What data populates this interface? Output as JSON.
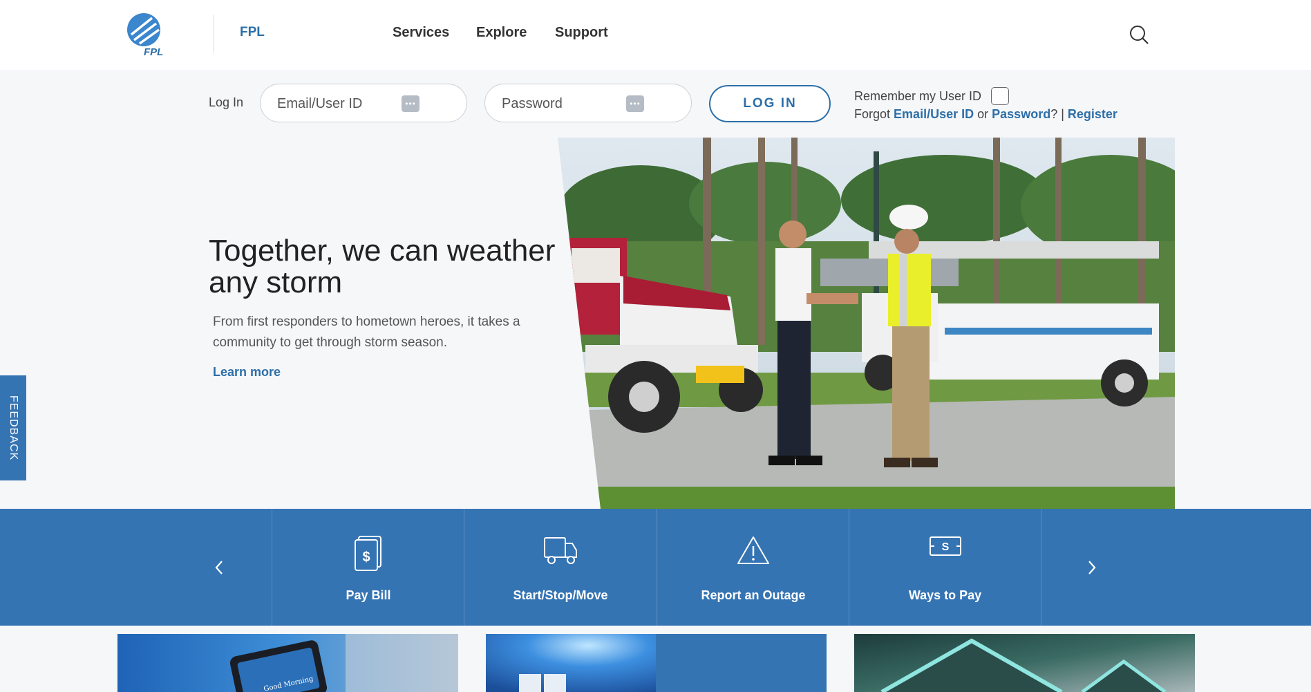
{
  "header": {
    "brand": "FPL",
    "logo_text": "FPL",
    "nav": [
      "Services",
      "Explore",
      "Support"
    ]
  },
  "login": {
    "label": "Log In",
    "email_placeholder": "Email/User ID",
    "password_placeholder": "Password",
    "button": "LOG IN",
    "remember": "Remember my User ID",
    "forgot_prefix": "Forgot",
    "forgot_email": "Email/User ID",
    "forgot_or": "or",
    "forgot_password": "Password",
    "forgot_suffix": "? |",
    "register": "Register"
  },
  "hero": {
    "title": "Together, we can weather any storm",
    "description": "From first responders to hometown heroes, it takes a community to get through storm season.",
    "link": "Learn more"
  },
  "feedback": "FEEDBACK",
  "actions": [
    {
      "label": "Pay Bill",
      "icon": "bill-dollar-icon"
    },
    {
      "label": "Start/Stop/Move",
      "icon": "truck-icon"
    },
    {
      "label": "Report an Outage",
      "icon": "warning-icon"
    },
    {
      "label": "Ways to Pay",
      "icon": "cash-icon"
    }
  ],
  "phone_screen_text": "Good Morning",
  "colors": {
    "brand_blue": "#2d6fa8",
    "action_bar": "#3574b3",
    "background": "#f6f7f9"
  }
}
